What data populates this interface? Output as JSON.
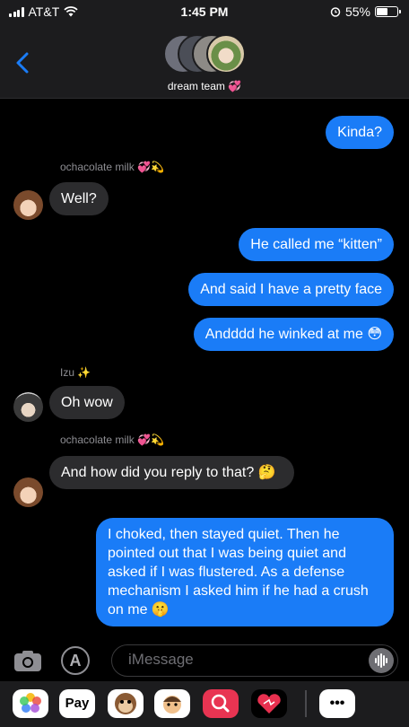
{
  "status_bar": {
    "carrier": "AT&T",
    "time": "1:45 PM",
    "battery": "55%",
    "battery_level": 0.55
  },
  "header": {
    "group_name": "dream team 💞"
  },
  "messages": [
    {
      "dir": "out",
      "text": "Kinda?"
    },
    {
      "dir": "sender",
      "text": "ochacolate milk 💞💫"
    },
    {
      "dir": "in",
      "text": "Well?"
    },
    {
      "dir": "out",
      "text": "He called me “kitten”"
    },
    {
      "dir": "out",
      "text": "And said I have a pretty face"
    },
    {
      "dir": "out",
      "text": "Andddd he winked at me 😳"
    },
    {
      "dir": "sender",
      "text": "Izu ✨"
    },
    {
      "dir": "in",
      "text": "Oh wow"
    },
    {
      "dir": "sender",
      "text": "ochacolate milk 💞💫"
    },
    {
      "dir": "in",
      "text": "And how did you reply to that? 🤔"
    },
    {
      "dir": "out",
      "text": "I choked, then stayed quiet. Then he pointed out that I was being quiet and asked if I was flustered. As a defense mechanism I asked him if he had a crush on me 🤫"
    }
  ],
  "input": {
    "placeholder": "iMessage"
  },
  "drawer": {
    "apps": [
      "photos-icon",
      "apple-pay-icon",
      "animoji-icon",
      "memoji-icon",
      "search-images-icon",
      "heart-icon",
      "more-icon"
    ],
    "apple_pay_label": "Pay",
    "more_label": "•••"
  },
  "colors": {
    "outgoing": "#1a7cf7",
    "incoming": "#2c2c2e",
    "background": "#000000"
  }
}
